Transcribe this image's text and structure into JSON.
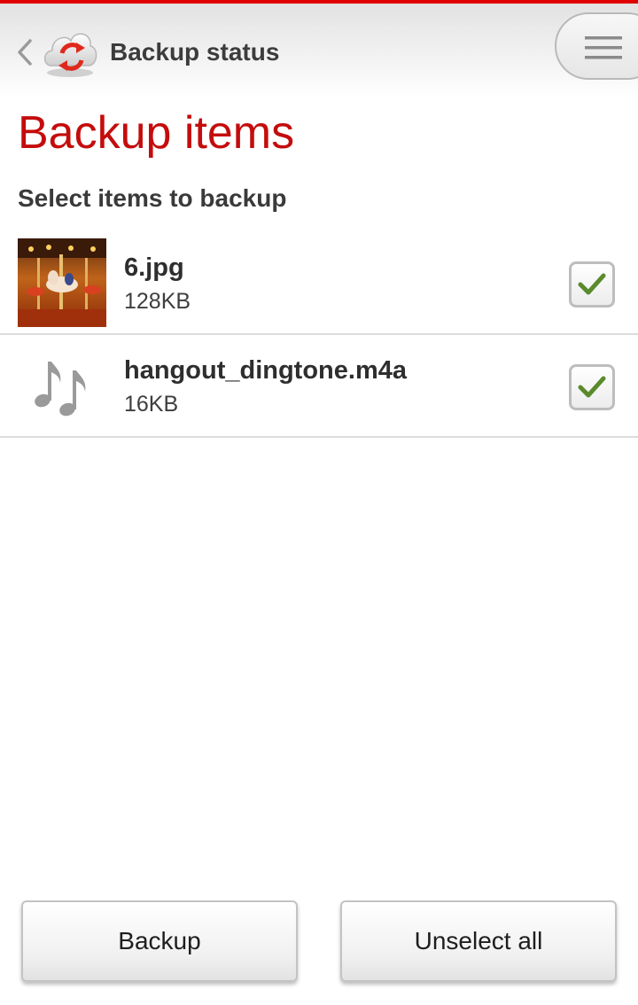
{
  "header": {
    "title": "Backup status",
    "back_icon": "chevron-left-icon",
    "app_icon": "cloud-sync-icon",
    "menu_icon": "hamburger-menu-icon"
  },
  "main": {
    "title": "Backup items",
    "subtitle": "Select items to backup",
    "items": [
      {
        "name": "6.jpg",
        "size": "128KB",
        "checked": true,
        "icon": "carousel-photo-thumbnail"
      },
      {
        "name": "hangout_dingtone.m4a",
        "size": "16KB",
        "checked": true,
        "icon": "music-note-icon"
      }
    ]
  },
  "buttons": {
    "backup": "Backup",
    "unselect_all": "Unselect all"
  },
  "colors": {
    "accent": "#c40c0c",
    "top_bar": "#e00000",
    "check": "#5a8a2c"
  }
}
